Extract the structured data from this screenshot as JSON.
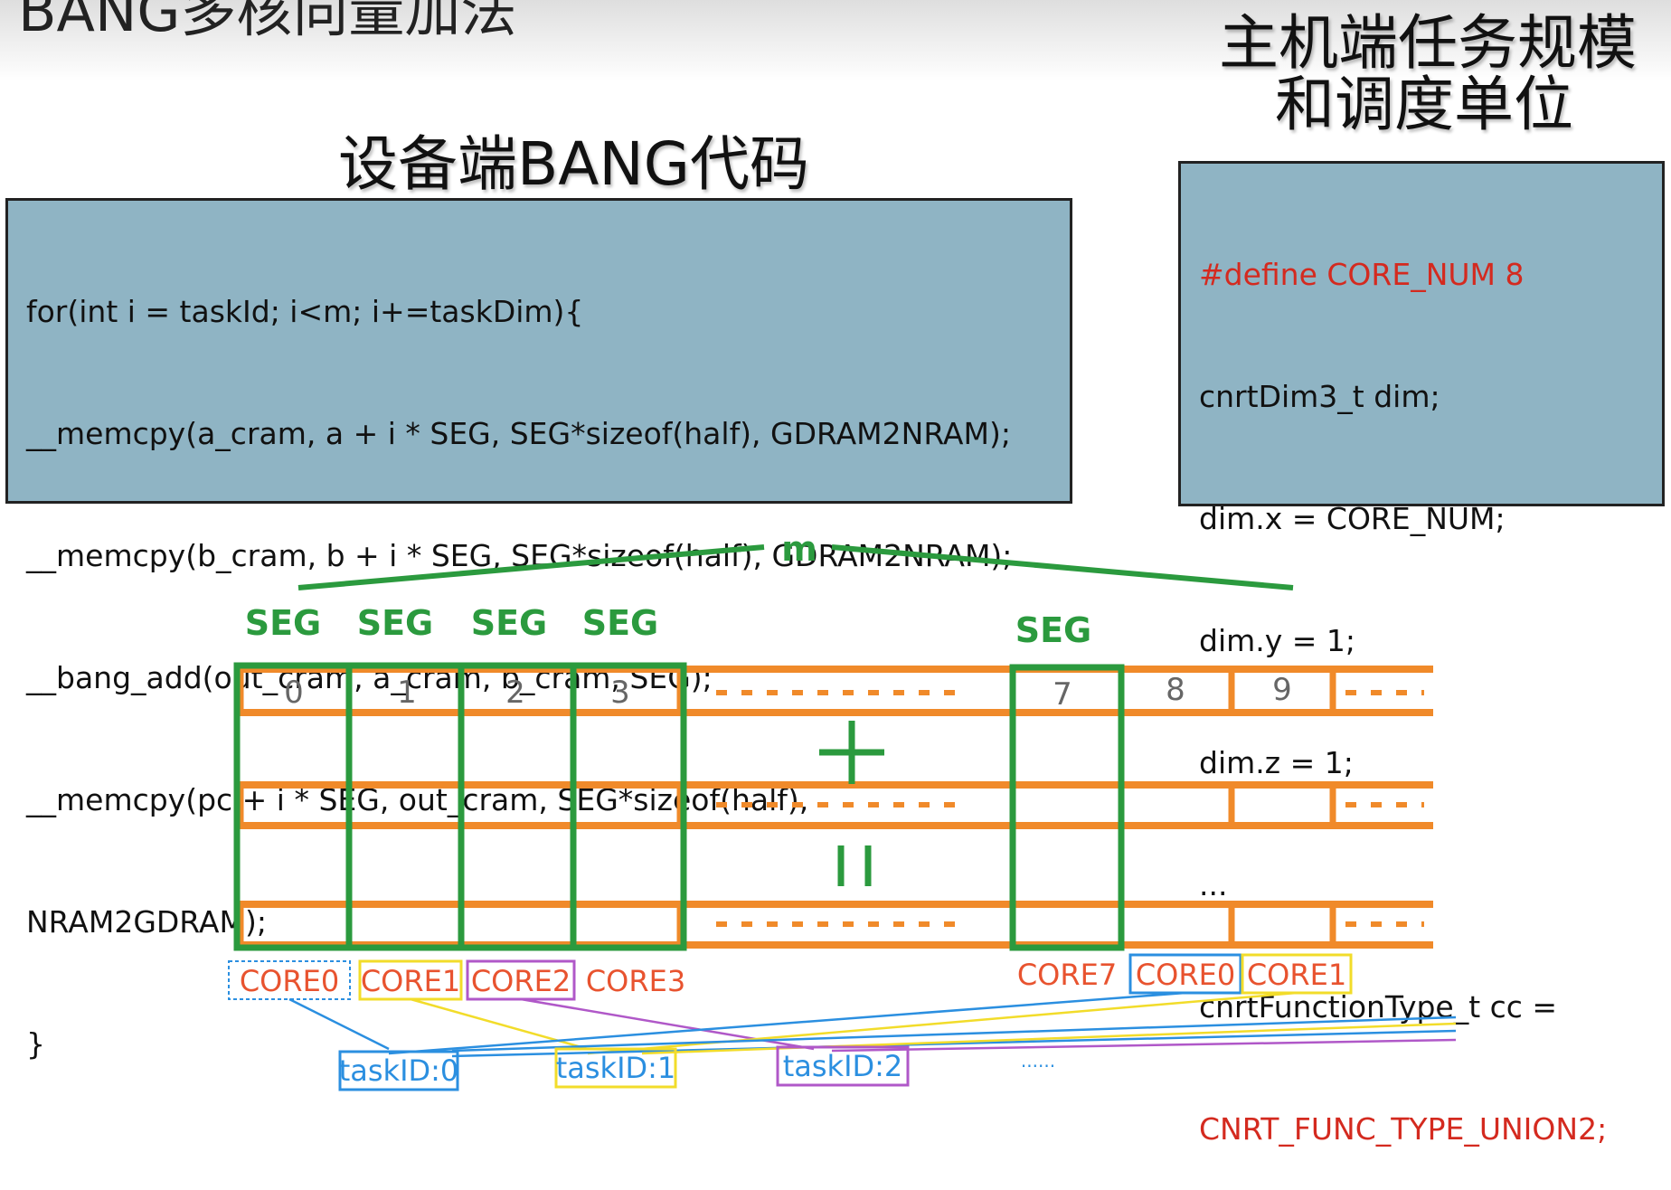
{
  "slide": {
    "title": "BANG多核向量加法"
  },
  "device_caption": "设备端BANG代码",
  "host_caption": {
    "line1": "主机端任务规模",
    "line2": "和调度单位"
  },
  "device_code": [
    "for(int i = taskId; i<m; i+=taskDim){",
    "__memcpy(a_cram, a + i * SEG, SEG*sizeof(half), GDRAM2NRAM);",
    "__memcpy(b_cram, b + i * SEG, SEG*sizeof(half), GDRAM2NRAM);",
    "__bang_add(out_cram, a_cram, b_cram, SEG);",
    "__memcpy(pc + i * SEG, out_cram, SEG*sizeof(half),",
    "NRAM2GDRAM);",
    "}"
  ],
  "host_code": {
    "define": "#define CORE_NUM 8",
    "lines": [
      "cnrtDim3_t dim;",
      "dim.x = CORE_NUM;",
      "dim.y = 1;",
      "dim.z = 1;",
      "...",
      "cnrtFunctionType_t cc ="
    ],
    "union": "CNRT_FUNC_TYPE_UNION2;"
  },
  "diagram": {
    "m_label": "m",
    "seg_label": "SEG",
    "indices": [
      "0",
      "1",
      "2",
      "3",
      "7",
      "8",
      "9"
    ],
    "plus": "+",
    "equals": "=",
    "core_labels": [
      "CORE0",
      "CORE1",
      "CORE2",
      "CORE3",
      "CORE7",
      "CORE0",
      "CORE1"
    ],
    "task_labels": [
      "taskID:0",
      "taskID:1",
      "taskID:2"
    ],
    "ellipsis": "......",
    "colors": {
      "green": "#2b9a3e",
      "orange": "#f08a2a",
      "core_text": "#e8532f",
      "blue": "#2b8fe0",
      "yellow": "#f2dc2a",
      "purple": "#b058c8",
      "code_bg": "#8fb4c4"
    }
  }
}
